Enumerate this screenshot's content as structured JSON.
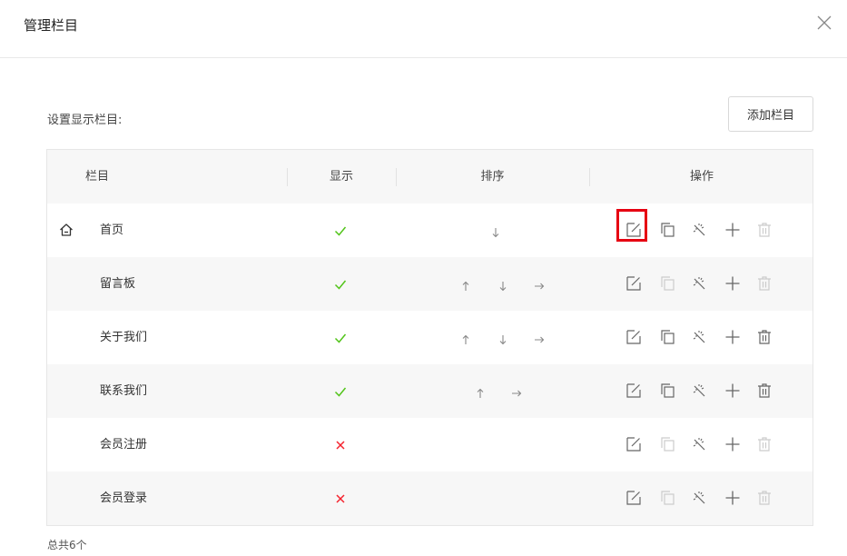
{
  "dialog": {
    "title": "管理栏目"
  },
  "section_label": "设置显示栏目:",
  "add_button_label": "添加栏目",
  "table": {
    "headers": {
      "column": "栏目",
      "display": "显示",
      "sort": "排序",
      "actions": "操作"
    },
    "rows": [
      {
        "name": "首页",
        "visible": true,
        "sort": [
          "down"
        ],
        "actions_enabled": {
          "edit": true,
          "copy": true,
          "link": true,
          "add": true,
          "delete": false
        },
        "is_home": true,
        "highlighted_action": "edit"
      },
      {
        "name": "留言板",
        "visible": true,
        "sort": [
          "up",
          "down",
          "right"
        ],
        "actions_enabled": {
          "edit": true,
          "copy": false,
          "link": true,
          "add": true,
          "delete": false
        }
      },
      {
        "name": "关于我们",
        "visible": true,
        "sort": [
          "up",
          "down",
          "right"
        ],
        "actions_enabled": {
          "edit": true,
          "copy": true,
          "link": true,
          "add": true,
          "delete": true
        }
      },
      {
        "name": "联系我们",
        "visible": true,
        "sort": [
          "up",
          "right"
        ],
        "actions_enabled": {
          "edit": true,
          "copy": true,
          "link": true,
          "add": true,
          "delete": true
        }
      },
      {
        "name": "会员注册",
        "visible": false,
        "sort": [],
        "actions_enabled": {
          "edit": true,
          "copy": false,
          "link": true,
          "add": true,
          "delete": false
        }
      },
      {
        "name": "会员登录",
        "visible": false,
        "sort": [],
        "actions_enabled": {
          "edit": true,
          "copy": false,
          "link": true,
          "add": true,
          "delete": false
        }
      }
    ]
  },
  "footer": {
    "count_text": "总共6个"
  },
  "icons": {
    "close": "close-icon",
    "home": "home-icon",
    "visible": "check-icon",
    "hidden": "cross-icon",
    "sort_up": "arrow-up-icon",
    "sort_down": "arrow-down-icon",
    "sort_right": "arrow-right-icon",
    "edit": "edit-icon",
    "copy": "copy-icon",
    "link": "magic-link-icon",
    "add": "plus-icon",
    "delete": "trash-icon"
  },
  "colors": {
    "check": "#52c41a",
    "cross": "#f5222d",
    "icon_enabled": "#666666",
    "icon_disabled": "#cccccc",
    "highlight": "#e60012",
    "row_alt": "#f7f7f7",
    "border": "#e6e6e6"
  }
}
